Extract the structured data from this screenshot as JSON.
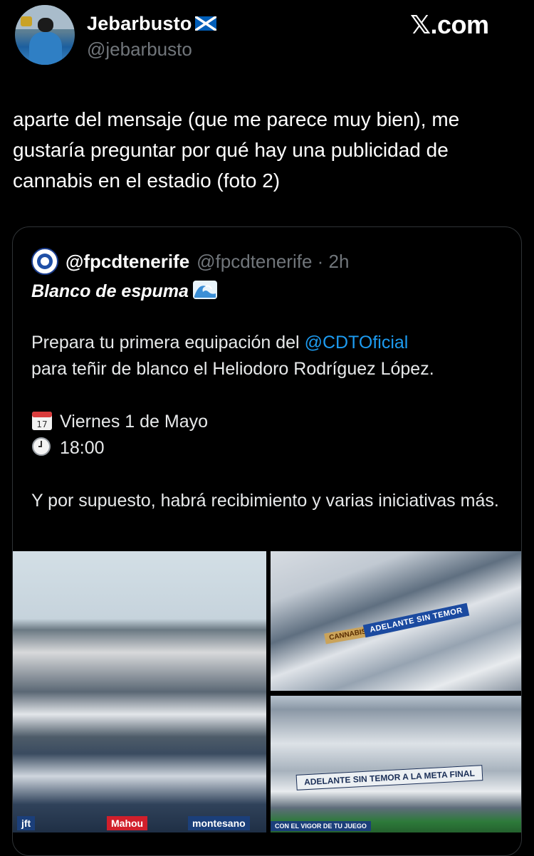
{
  "header": {
    "display_name": "Jebarbusto",
    "handle": "@jebarbusto",
    "site": "𝕏.com"
  },
  "tweet": {
    "text": "aparte del mensaje (que me parece muy bien), me gustaría preguntar por qué hay una publicidad de cannabis en el estadio (foto 2)"
  },
  "quote": {
    "name": "@fpcdtenerife",
    "meta": "@fpcdtenerife · 2h",
    "title": "Blanco de espuma",
    "body_line1_prefix": "Prepara tu primera equipación del ",
    "mention": "@CDTOficial",
    "body_line2": "para teñir de blanco el Heliodoro Rodríguez López.",
    "date": "Viernes 1 de Mayo",
    "time": "18:00",
    "closing": "Y por supuesto, habrá recibimiento y varias iniciativas más."
  },
  "photos": {
    "p1_banners": [
      "jft",
      "Mahou",
      "montesano"
    ],
    "p2_banners": [
      "ADELANTE SIN TEMOR",
      "CANNABIS"
    ],
    "p3_banners": [
      "ADELANTE SIN TEMOR A LA META FINAL",
      "CON EL VIGOR DE TU JUEGO"
    ]
  },
  "icons": {
    "flag": "scotland-flag-icon",
    "wave": "wave-emoji-icon",
    "calendar": "calendar-icon",
    "clock": "clock-icon"
  }
}
